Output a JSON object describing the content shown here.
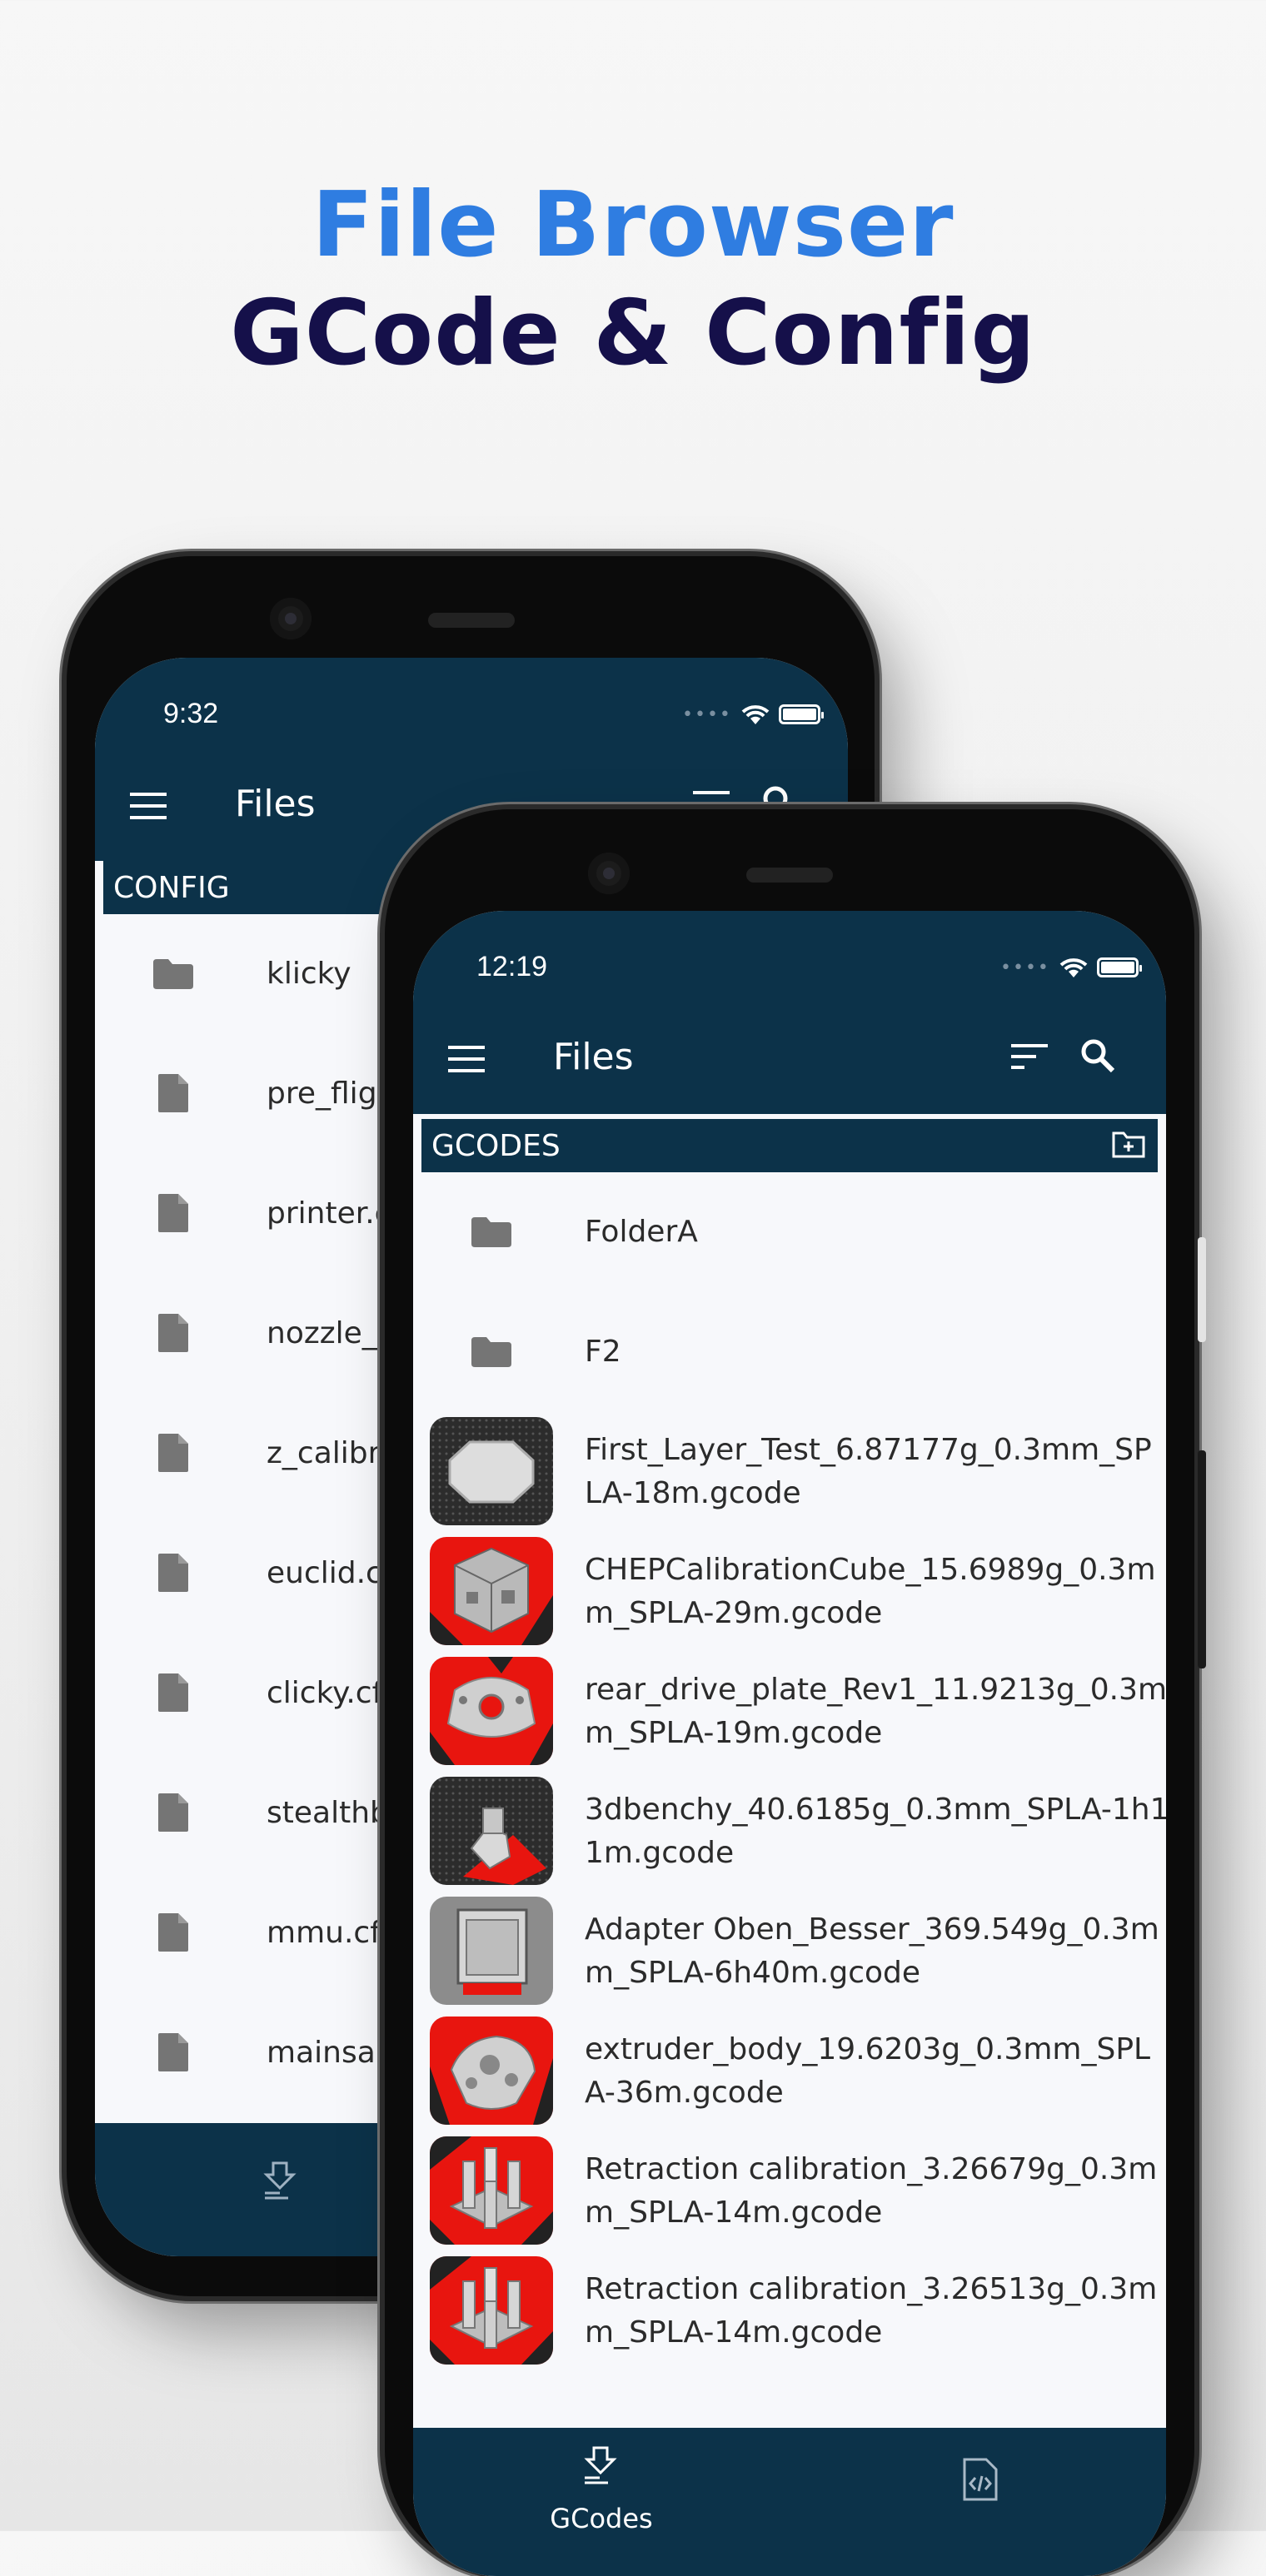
{
  "headline": {
    "line1": "File Browser",
    "line2": "GCode & Config"
  },
  "back_phone": {
    "status_time": "9:32",
    "toolbar_title": "Files",
    "section_title": "CONFIG",
    "items": [
      {
        "type": "folder",
        "name": "klicky"
      },
      {
        "type": "file",
        "name": "pre_flig"
      },
      {
        "type": "file",
        "name": "printer.c"
      },
      {
        "type": "file",
        "name": "nozzle_s"
      },
      {
        "type": "file",
        "name": "z_calibr"
      },
      {
        "type": "file",
        "name": "euclid.c"
      },
      {
        "type": "file",
        "name": "clicky.cf"
      },
      {
        "type": "file",
        "name": "stealthb"
      },
      {
        "type": "file",
        "name": "mmu.cf"
      },
      {
        "type": "file",
        "name": "mainsai"
      }
    ]
  },
  "front_phone": {
    "status_time": "12:19",
    "toolbar_title": "Files",
    "section_title": "GCODES",
    "folders": [
      {
        "name": "FolderA"
      },
      {
        "name": "F2"
      }
    ],
    "files": [
      {
        "line1": "First_Layer_Test_6.87177g_0.3mm_SP",
        "line2": "LA-18m.gcode",
        "thumb": "octagon-plate"
      },
      {
        "line1": "CHEPCalibrationCube_15.6989g_0.3m",
        "line2": "m_SPLA-29m.gcode",
        "thumb": "cube"
      },
      {
        "line1": "rear_drive_plate_Rev1_11.9213g_0.3m",
        "line2": "m_SPLA-19m.gcode",
        "thumb": "plate"
      },
      {
        "line1": "3dbenchy_40.6185g_0.3mm_SPLA-1h1",
        "line2": "1m.gcode",
        "thumb": "benchy"
      },
      {
        "line1": "Adapter Oben_Besser_369.549g_0.3m",
        "line2": "m_SPLA-6h40m.gcode",
        "thumb": "adapter"
      },
      {
        "line1": "extruder_body_19.6203g_0.3mm_SPL",
        "line2": "A-36m.gcode",
        "thumb": "extruder"
      },
      {
        "line1": "Retraction calibration_3.26679g_0.3m",
        "line2": "m_SPLA-14m.gcode",
        "thumb": "towers"
      },
      {
        "line1": "Retraction calibration_3.26513g_0.3m",
        "line2": "m_SPLA-14m.gcode",
        "thumb": "towers"
      }
    ],
    "nav": {
      "gcodes_label": "GCodes"
    }
  },
  "colors": {
    "appbar": "#0c3249",
    "accent_blue": "#2f7de1",
    "headline_dark": "#15104a",
    "thumb_red": "#e8150f"
  }
}
